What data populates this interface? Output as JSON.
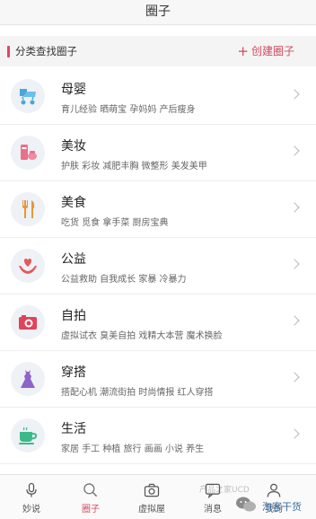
{
  "header": {
    "title": "圈子"
  },
  "section": {
    "label": "分类查找圈子",
    "create_icon": "+",
    "create_label": "创建圈子"
  },
  "categories": [
    {
      "name": "母婴",
      "tags": "育儿经验 晒萌宝 孕妈妈 产后瘦身",
      "icon": "stroller-icon",
      "color": "#4aa7d8"
    },
    {
      "name": "美妆",
      "tags": "护肤 彩妆 减肥丰胸 微整形 美发美甲",
      "icon": "cosmetics-icon",
      "color": "#e87089"
    },
    {
      "name": "美食",
      "tags": "吃货 觅食 拿手菜 厨房宝典",
      "icon": "cutlery-icon",
      "color": "#e6973a"
    },
    {
      "name": "公益",
      "tags": "公益救助 自我成长 家暴 冷暴力",
      "icon": "heart-hands-icon",
      "color": "#e25a5a"
    },
    {
      "name": "自拍",
      "tags": "虚拟试衣 臭美自拍 戏精大本营 魔术换脸",
      "icon": "camera-icon",
      "color": "#e0435a"
    },
    {
      "name": "穿搭",
      "tags": "搭配心机 潮流街拍 时尚情报 红人穿搭",
      "icon": "dress-icon",
      "color": "#8f63c9"
    },
    {
      "name": "生活",
      "tags": "家居 手工 种植 旅行 画画 小说 养生",
      "icon": "cup-icon",
      "color": "#3cb98a"
    }
  ],
  "tabs": [
    {
      "label": "妙说",
      "icon": "microphone-icon",
      "active": false
    },
    {
      "label": "圈子",
      "icon": "search-icon",
      "active": true
    },
    {
      "label": "虚拟屋",
      "icon": "camera-icon",
      "active": false
    },
    {
      "label": "消息",
      "icon": "chat-icon",
      "active": false
    },
    {
      "label": "我的",
      "icon": "user-icon",
      "active": false
    }
  ],
  "watermark": {
    "text": "淘客干货",
    "ghost_text": "产品之家UCD",
    "icon": "wechat-icon"
  },
  "colors": {
    "accent": "#d04a5e",
    "bar": "#e2465f"
  }
}
